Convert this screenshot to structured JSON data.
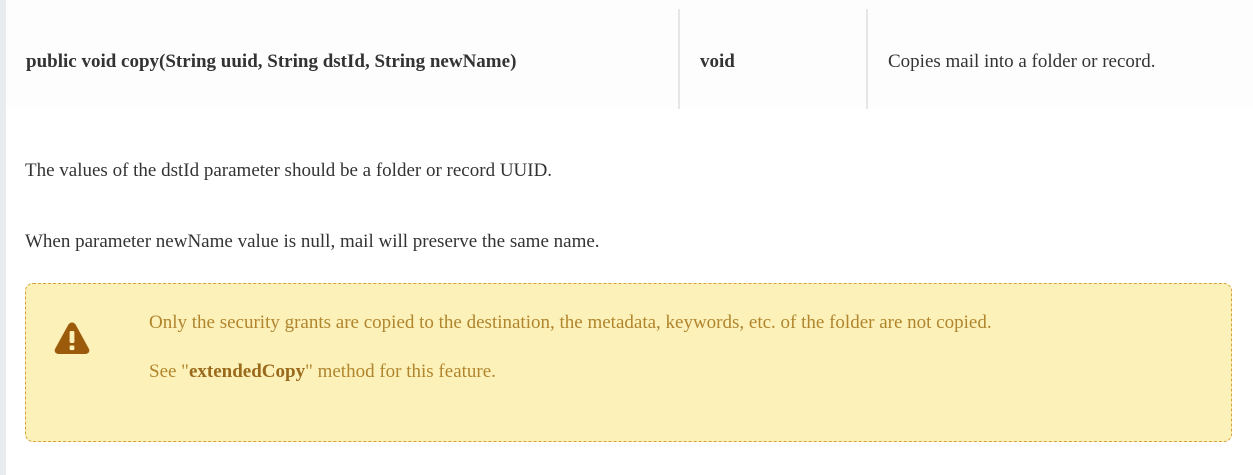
{
  "method_row": {
    "signature": "public void copy(String uuid, String dstId, String newName)",
    "return_type": "void",
    "description": "Copies mail into a folder or record."
  },
  "paragraphs": {
    "dstid_note": "The values of the dstId parameter should be a folder or record UUID.",
    "newname_note": "When parameter newName value is null, mail will preserve the same name."
  },
  "warning": {
    "icon": "warning-triangle-icon",
    "text": "Only the security grants are copied to the destination, the metadata, keywords, etc. of the folder are not copied.",
    "see_prefix": "See \"",
    "see_method": "extendedCopy",
    "see_suffix": "\" method for this feature."
  },
  "colors": {
    "warning_background": "#fcf1b8",
    "warning_border": "#d6a33a",
    "warning_icon": "#9c5a0b",
    "warning_text": "#b0852e"
  }
}
